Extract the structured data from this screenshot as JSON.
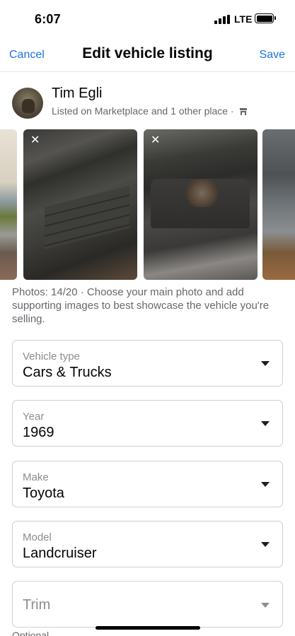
{
  "status": {
    "time": "6:07",
    "network": "LTE"
  },
  "nav": {
    "cancel_label": "Cancel",
    "title": "Edit vehicle listing",
    "save_label": "Save"
  },
  "seller": {
    "name": "Tim Egli",
    "subtitle": "Listed on Marketplace and 1 other place ·"
  },
  "photos": {
    "help_text": "Photos: 14/20 · Choose your main photo and add supporting images to best showcase the vehicle you're selling."
  },
  "fields": [
    {
      "label": "Vehicle type",
      "value": "Cars & Trucks"
    },
    {
      "label": "Year",
      "value": "1969"
    },
    {
      "label": "Make",
      "value": "Toyota"
    },
    {
      "label": "Model",
      "value": "Landcruiser"
    },
    {
      "label": "",
      "placeholder": "Trim",
      "value": ""
    }
  ],
  "footer": {
    "optional_label": "Optional"
  },
  "colors": {
    "accent": "#1b74e4",
    "muted": "#65676b",
    "border": "#ced0d4"
  }
}
